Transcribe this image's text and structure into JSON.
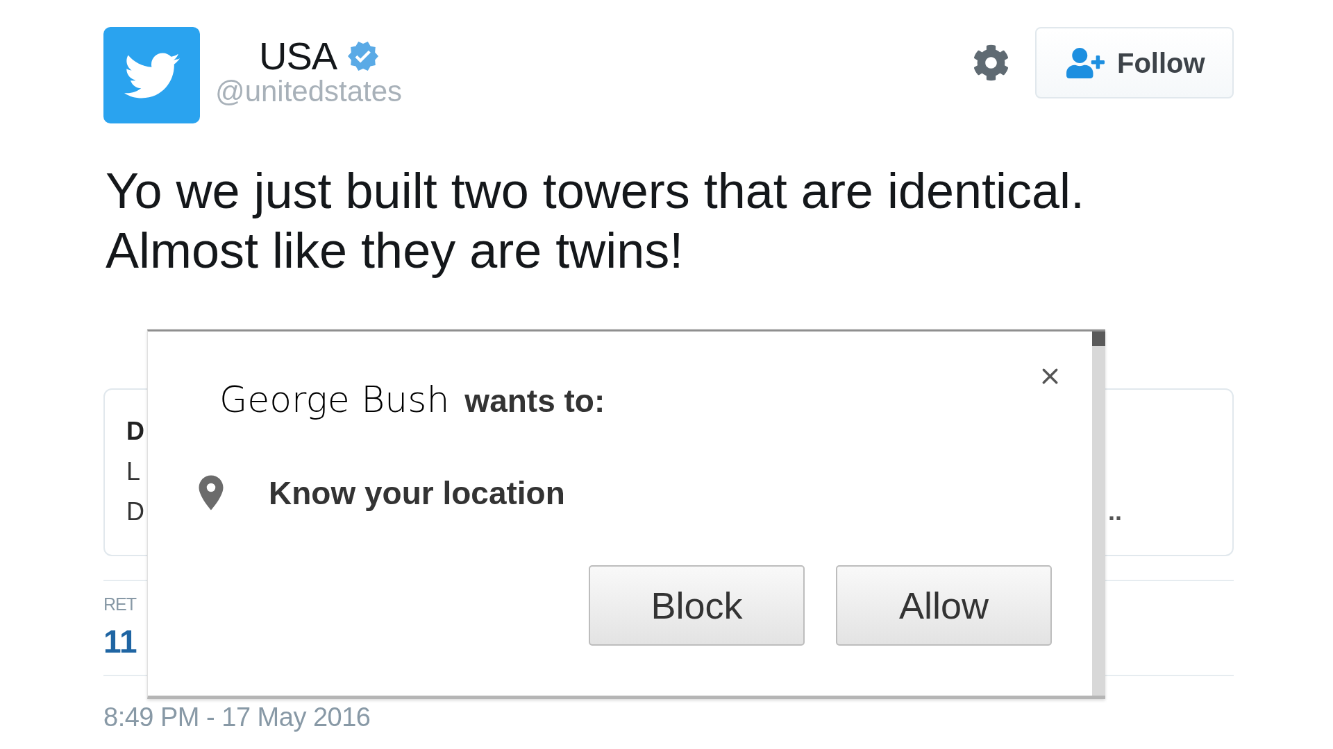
{
  "tweet": {
    "author": {
      "name": "USA",
      "handle": "@unitedstates",
      "verified": true
    },
    "follow_button": {
      "label": "Follow"
    },
    "text_lines": [
      "Yo we just built two towers that are identical.",
      "Almost like they are twins!"
    ],
    "card": {
      "lines": [
        {
          "text": "D",
          "bold": true
        },
        {
          "text": "L",
          "bold": false
        },
        {
          "text": "D",
          "bold": false
        }
      ],
      "overflow_text": ".."
    },
    "stats": {
      "label": "RET",
      "count": "11"
    },
    "timestamp": "8:49 PM - 17 May 2016"
  },
  "permission_dialog": {
    "site": "George Bush",
    "prompt": "wants to:",
    "permission": "Know your location",
    "buttons": [
      {
        "label": "Block"
      },
      {
        "label": "Allow"
      }
    ]
  }
}
